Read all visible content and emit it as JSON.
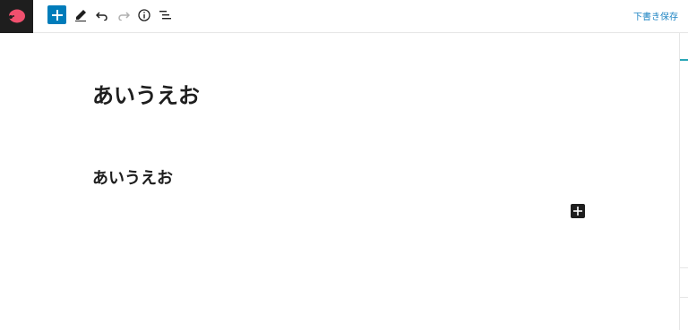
{
  "toolbar": {
    "icons": [
      "add-block-icon",
      "pencil-icon",
      "undo-icon",
      "redo-icon",
      "info-icon",
      "list-view-icon"
    ],
    "save_draft_label": "下書き保存",
    "accent_color": "#007cba"
  },
  "editor": {
    "post_title": "あいうえお",
    "heading_block": "あいうえお"
  }
}
